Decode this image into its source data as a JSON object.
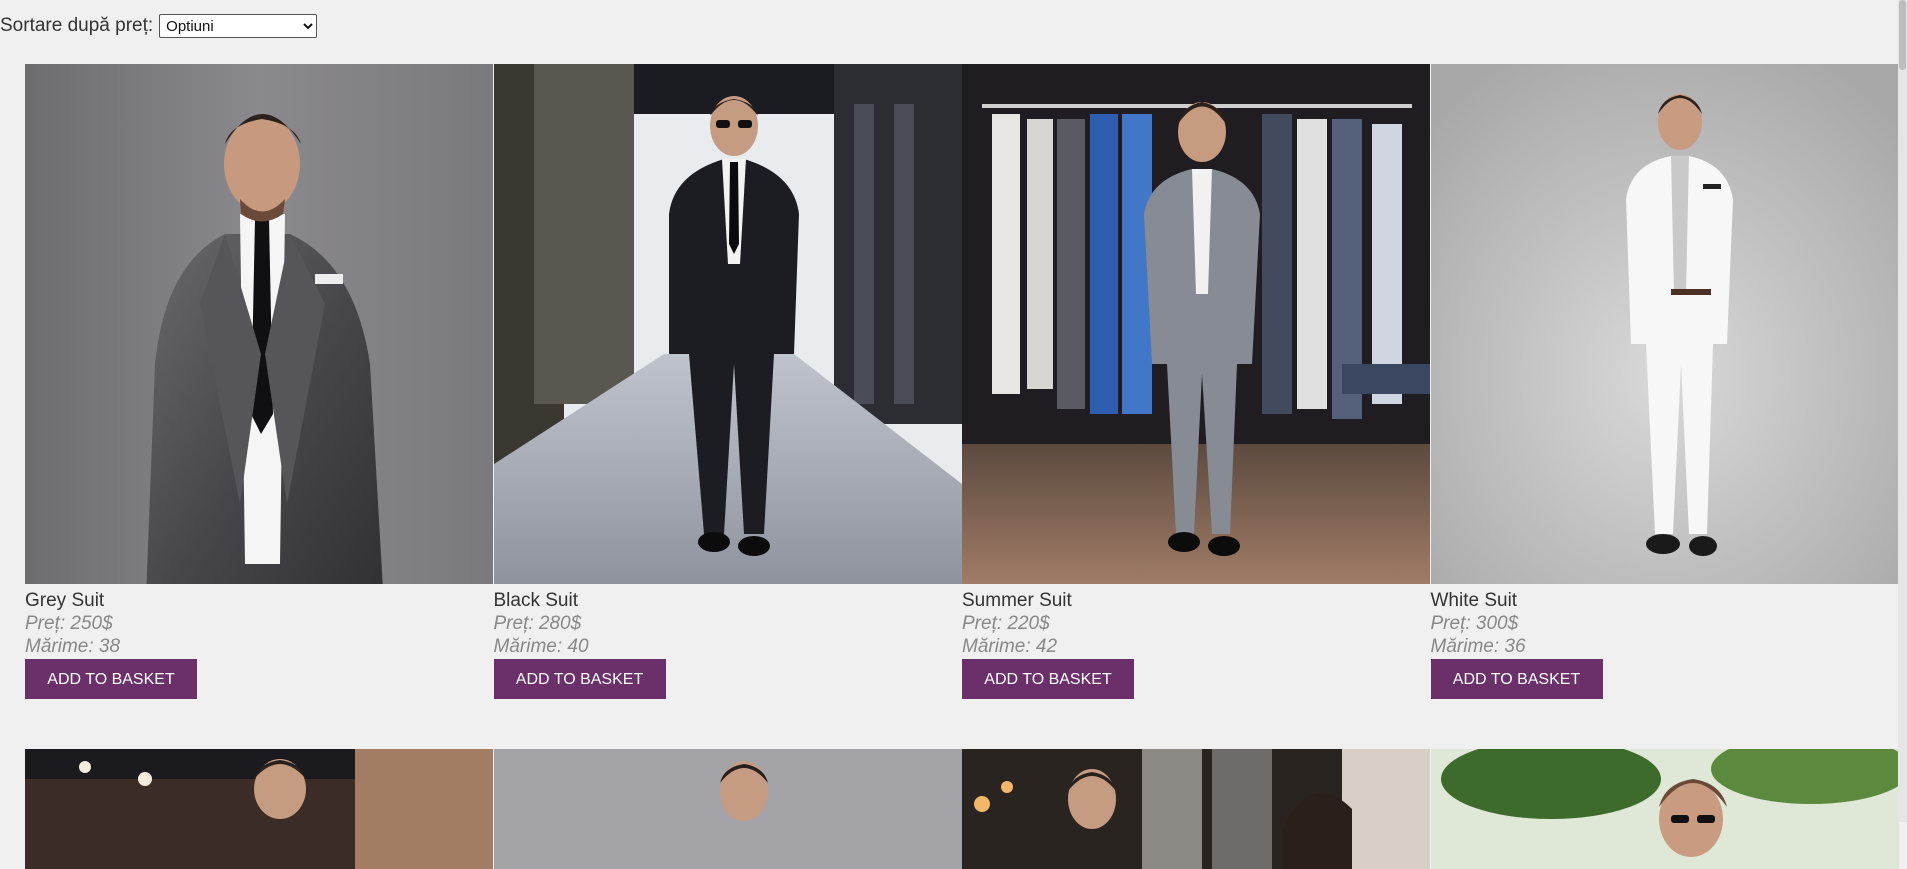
{
  "sort": {
    "label": "Sortare după preț:",
    "selected": "Optiuni"
  },
  "products": [
    {
      "name": "Grey Suit",
      "price": "Preț: 250$",
      "size": "Mărime: 38",
      "button": "ADD TO BASKET"
    },
    {
      "name": "Black Suit",
      "price": "Preț: 280$",
      "size": "Mărime: 40",
      "button": "ADD TO BASKET"
    },
    {
      "name": "Summer Suit",
      "price": "Preț: 220$",
      "size": "Mărime: 42",
      "button": "ADD TO BASKET"
    },
    {
      "name": "White Suit",
      "price": "Preț: 300$",
      "size": "Mărime: 36",
      "button": "ADD TO BASKET"
    }
  ],
  "colors": {
    "button": "#6b2f6a",
    "background": "#f0f0f0"
  }
}
